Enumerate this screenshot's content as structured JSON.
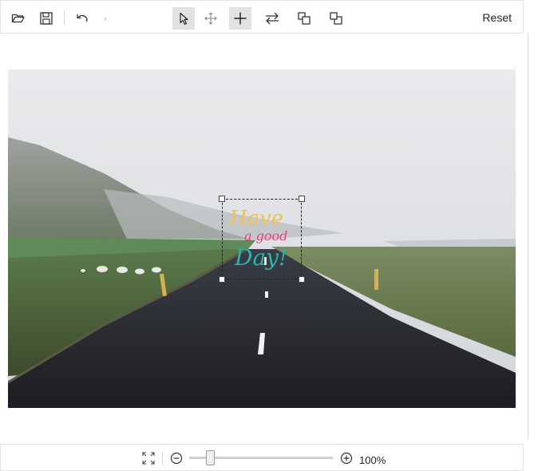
{
  "toolbar": {
    "icons": {
      "open": "folder-open-icon",
      "save": "save-icon",
      "undo": "undo-icon",
      "redo": "redo-icon",
      "select": "pointer-select-icon",
      "pan": "move-arrows-icon",
      "crosshair": "crosshair-icon",
      "swap": "swap-arrows-icon",
      "bring_forward": "bring-forward-icon",
      "send_backward": "send-backward-icon"
    },
    "active_tools": [
      "select",
      "crosshair"
    ],
    "reset_label": "Reset"
  },
  "canvas": {
    "image_description_icon": "road-landscape-photo",
    "overlay_text_lines": [
      "Have",
      "a good",
      "Day!"
    ],
    "overlay_colors": [
      "#f2c14e",
      "#e83f84",
      "#27b5b0"
    ]
  },
  "bottombar": {
    "fit_icon": "fit-to-screen-icon",
    "zoom_out_icon": "zoom-out-icon",
    "zoom_in_icon": "zoom-in-icon",
    "zoom_value": 0.15,
    "zoom_label": "100%"
  }
}
